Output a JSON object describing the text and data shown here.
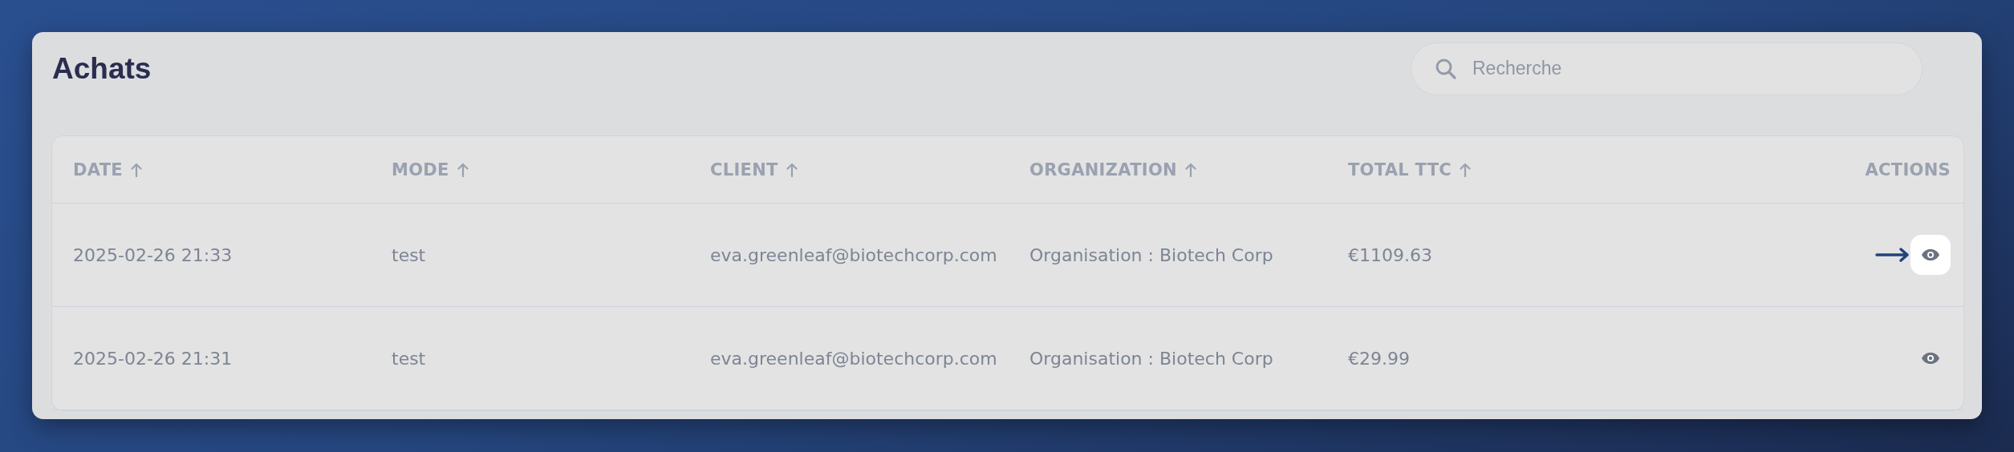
{
  "page": {
    "title": "Achats"
  },
  "search": {
    "placeholder": "Recherche"
  },
  "table": {
    "columns": [
      {
        "label": "DATE",
        "sortable": true
      },
      {
        "label": "MODE",
        "sortable": true
      },
      {
        "label": "CLIENT",
        "sortable": true
      },
      {
        "label": "ORGANIZATION",
        "sortable": true
      },
      {
        "label": "TOTAL TTC",
        "sortable": true
      },
      {
        "label": "ACTIONS",
        "sortable": false
      }
    ],
    "rows": [
      {
        "cells": [
          "2025-02-26 21:33",
          "test",
          "eva.greenleaf@biotechcorp.com",
          "Organisation : Biotech Corp",
          "€1109.63"
        ],
        "highlighted": true
      },
      {
        "cells": [
          "2025-02-26 21:31",
          "test",
          "eva.greenleaf@biotechcorp.com",
          "Organisation : Biotech Corp",
          "€29.99"
        ],
        "highlighted": false
      }
    ]
  }
}
